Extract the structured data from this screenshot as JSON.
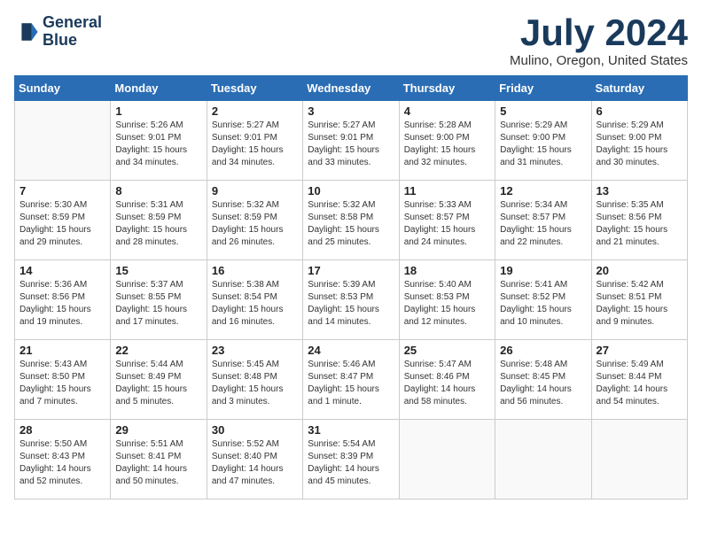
{
  "logo": {
    "line1": "General",
    "line2": "Blue"
  },
  "title": "July 2024",
  "location": "Mulino, Oregon, United States",
  "days_of_week": [
    "Sunday",
    "Monday",
    "Tuesday",
    "Wednesday",
    "Thursday",
    "Friday",
    "Saturday"
  ],
  "weeks": [
    [
      {
        "day": "",
        "content": ""
      },
      {
        "day": "1",
        "content": "Sunrise: 5:26 AM\nSunset: 9:01 PM\nDaylight: 15 hours\nand 34 minutes."
      },
      {
        "day": "2",
        "content": "Sunrise: 5:27 AM\nSunset: 9:01 PM\nDaylight: 15 hours\nand 34 minutes."
      },
      {
        "day": "3",
        "content": "Sunrise: 5:27 AM\nSunset: 9:01 PM\nDaylight: 15 hours\nand 33 minutes."
      },
      {
        "day": "4",
        "content": "Sunrise: 5:28 AM\nSunset: 9:00 PM\nDaylight: 15 hours\nand 32 minutes."
      },
      {
        "day": "5",
        "content": "Sunrise: 5:29 AM\nSunset: 9:00 PM\nDaylight: 15 hours\nand 31 minutes."
      },
      {
        "day": "6",
        "content": "Sunrise: 5:29 AM\nSunset: 9:00 PM\nDaylight: 15 hours\nand 30 minutes."
      }
    ],
    [
      {
        "day": "7",
        "content": "Sunrise: 5:30 AM\nSunset: 8:59 PM\nDaylight: 15 hours\nand 29 minutes."
      },
      {
        "day": "8",
        "content": "Sunrise: 5:31 AM\nSunset: 8:59 PM\nDaylight: 15 hours\nand 28 minutes."
      },
      {
        "day": "9",
        "content": "Sunrise: 5:32 AM\nSunset: 8:59 PM\nDaylight: 15 hours\nand 26 minutes."
      },
      {
        "day": "10",
        "content": "Sunrise: 5:32 AM\nSunset: 8:58 PM\nDaylight: 15 hours\nand 25 minutes."
      },
      {
        "day": "11",
        "content": "Sunrise: 5:33 AM\nSunset: 8:57 PM\nDaylight: 15 hours\nand 24 minutes."
      },
      {
        "day": "12",
        "content": "Sunrise: 5:34 AM\nSunset: 8:57 PM\nDaylight: 15 hours\nand 22 minutes."
      },
      {
        "day": "13",
        "content": "Sunrise: 5:35 AM\nSunset: 8:56 PM\nDaylight: 15 hours\nand 21 minutes."
      }
    ],
    [
      {
        "day": "14",
        "content": "Sunrise: 5:36 AM\nSunset: 8:56 PM\nDaylight: 15 hours\nand 19 minutes."
      },
      {
        "day": "15",
        "content": "Sunrise: 5:37 AM\nSunset: 8:55 PM\nDaylight: 15 hours\nand 17 minutes."
      },
      {
        "day": "16",
        "content": "Sunrise: 5:38 AM\nSunset: 8:54 PM\nDaylight: 15 hours\nand 16 minutes."
      },
      {
        "day": "17",
        "content": "Sunrise: 5:39 AM\nSunset: 8:53 PM\nDaylight: 15 hours\nand 14 minutes."
      },
      {
        "day": "18",
        "content": "Sunrise: 5:40 AM\nSunset: 8:53 PM\nDaylight: 15 hours\nand 12 minutes."
      },
      {
        "day": "19",
        "content": "Sunrise: 5:41 AM\nSunset: 8:52 PM\nDaylight: 15 hours\nand 10 minutes."
      },
      {
        "day": "20",
        "content": "Sunrise: 5:42 AM\nSunset: 8:51 PM\nDaylight: 15 hours\nand 9 minutes."
      }
    ],
    [
      {
        "day": "21",
        "content": "Sunrise: 5:43 AM\nSunset: 8:50 PM\nDaylight: 15 hours\nand 7 minutes."
      },
      {
        "day": "22",
        "content": "Sunrise: 5:44 AM\nSunset: 8:49 PM\nDaylight: 15 hours\nand 5 minutes."
      },
      {
        "day": "23",
        "content": "Sunrise: 5:45 AM\nSunset: 8:48 PM\nDaylight: 15 hours\nand 3 minutes."
      },
      {
        "day": "24",
        "content": "Sunrise: 5:46 AM\nSunset: 8:47 PM\nDaylight: 15 hours\nand 1 minute."
      },
      {
        "day": "25",
        "content": "Sunrise: 5:47 AM\nSunset: 8:46 PM\nDaylight: 14 hours\nand 58 minutes."
      },
      {
        "day": "26",
        "content": "Sunrise: 5:48 AM\nSunset: 8:45 PM\nDaylight: 14 hours\nand 56 minutes."
      },
      {
        "day": "27",
        "content": "Sunrise: 5:49 AM\nSunset: 8:44 PM\nDaylight: 14 hours\nand 54 minutes."
      }
    ],
    [
      {
        "day": "28",
        "content": "Sunrise: 5:50 AM\nSunset: 8:43 PM\nDaylight: 14 hours\nand 52 minutes."
      },
      {
        "day": "29",
        "content": "Sunrise: 5:51 AM\nSunset: 8:41 PM\nDaylight: 14 hours\nand 50 minutes."
      },
      {
        "day": "30",
        "content": "Sunrise: 5:52 AM\nSunset: 8:40 PM\nDaylight: 14 hours\nand 47 minutes."
      },
      {
        "day": "31",
        "content": "Sunrise: 5:54 AM\nSunset: 8:39 PM\nDaylight: 14 hours\nand 45 minutes."
      },
      {
        "day": "",
        "content": ""
      },
      {
        "day": "",
        "content": ""
      },
      {
        "day": "",
        "content": ""
      }
    ]
  ]
}
